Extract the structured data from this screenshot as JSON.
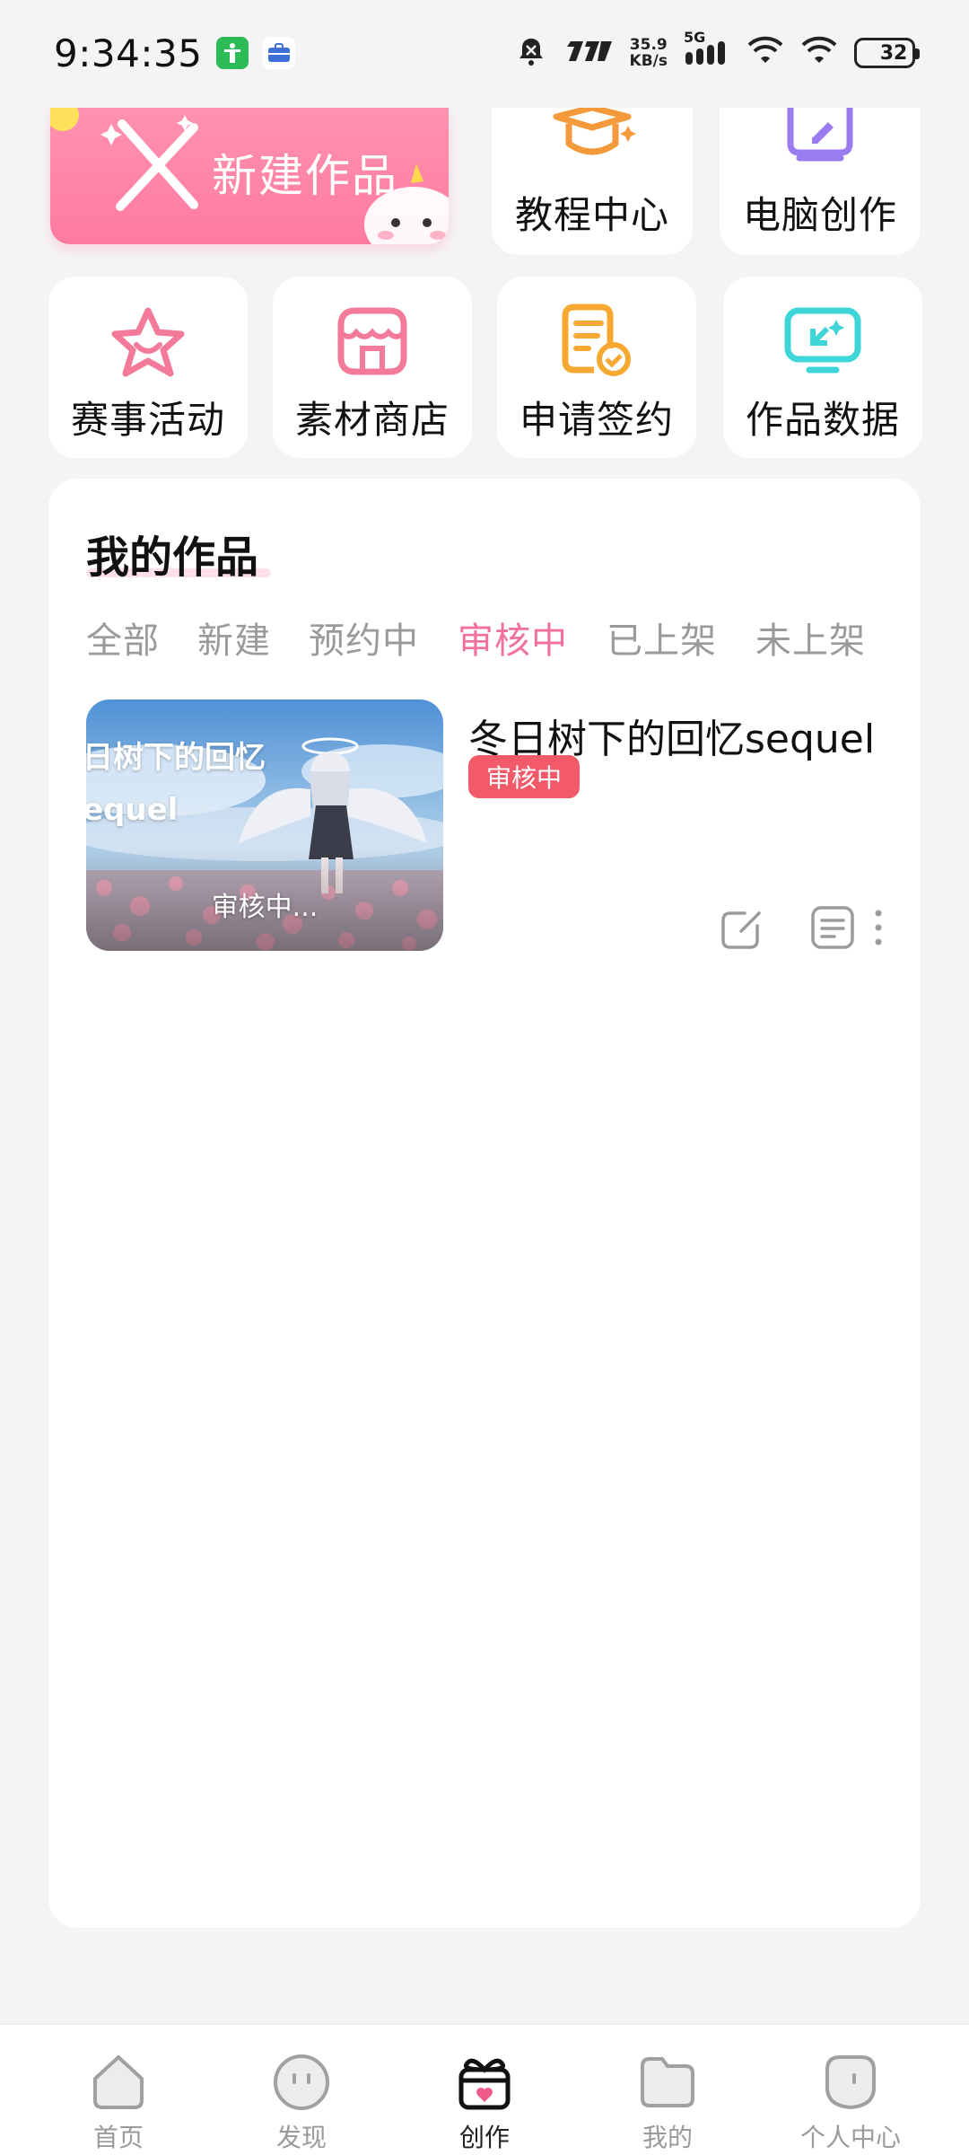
{
  "status_bar": {
    "time": "9:34:35",
    "net_speed_value": "35.9",
    "net_speed_unit": "KB/s",
    "network_type": "5G",
    "battery": "32"
  },
  "shortcuts": {
    "create_new_label": "新建作品",
    "tutorial_label": "教程中心",
    "pc_create_label": "电脑创作",
    "events_label": "赛事活动",
    "material_shop_label": "素材商店",
    "apply_contract_label": "申请签约",
    "works_data_label": "作品数据"
  },
  "my_works": {
    "title": "我的作品",
    "tabs": [
      "全部",
      "新建",
      "预约中",
      "审核中",
      "已上架",
      "未上架"
    ],
    "active_tab": "审核中",
    "items": [
      {
        "name": "冬日树下的回忆sequel",
        "thumb_title": "日树下的回忆\nequel",
        "thumb_status": "审核中...",
        "status_badge": "审核中"
      }
    ]
  },
  "bottom_nav": {
    "items": [
      {
        "label": "首页",
        "icon": "home-icon"
      },
      {
        "label": "发现",
        "icon": "discover-icon"
      },
      {
        "label": "创作",
        "icon": "gift-icon"
      },
      {
        "label": "我的",
        "icon": "folder-icon"
      },
      {
        "label": "个人中心",
        "icon": "profile-icon"
      }
    ],
    "active": "创作"
  },
  "colors": {
    "accent_pink": "#f27198",
    "badge_red": "#f25a6a",
    "banner_pink": "#ff85a8"
  }
}
